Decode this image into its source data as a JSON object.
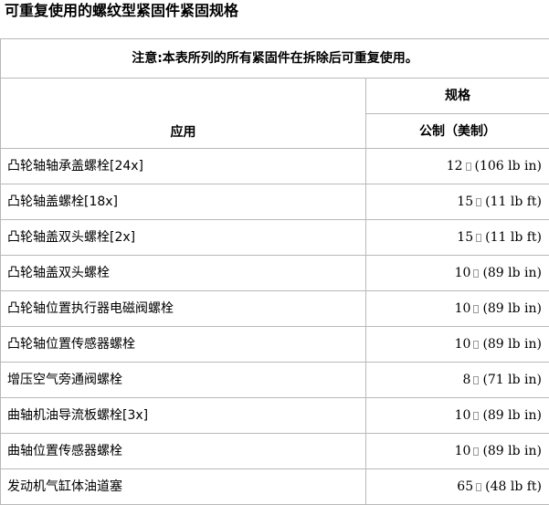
{
  "page": {
    "title": "可重复使用的螺纹型紧固件紧固规格"
  },
  "table": {
    "note": "注意:本表所列的所有紧固件在拆除后可重复使用。",
    "header_application": "应用",
    "header_spec": "规格",
    "header_units": "公制（美制）",
    "rows": [
      {
        "application": "凸轮轴轴承盖螺栓[24x]",
        "metric": "12",
        "us": "(106 lb in)"
      },
      {
        "application": "凸轮轴盖螺栓[18x]",
        "metric": "15",
        "us": "(11 lb ft)"
      },
      {
        "application": "凸轮轴盖双头螺栓[2x]",
        "metric": "15",
        "us": "(11 lb ft)"
      },
      {
        "application": "凸轮轴盖双头螺栓",
        "metric": "10",
        "us": "(89 lb in)"
      },
      {
        "application": "凸轮轴位置执行器电磁阀螺栓",
        "metric": "10",
        "us": "(89 lb in)"
      },
      {
        "application": "凸轮轴位置传感器螺栓",
        "metric": "10",
        "us": "(89 lb in)"
      },
      {
        "application": "增压空气旁通阀螺栓",
        "metric": "8",
        "us": "(71 lb in)"
      },
      {
        "application": "曲轴机油导流板螺栓[3x]",
        "metric": "10",
        "us": "(89 lb in)"
      },
      {
        "application": "曲轴位置传感器螺栓",
        "metric": "10",
        "us": "(89 lb in)"
      },
      {
        "application": "发动机气缸体油道塞",
        "metric": "65",
        "us": "(48 lb ft)"
      }
    ]
  }
}
